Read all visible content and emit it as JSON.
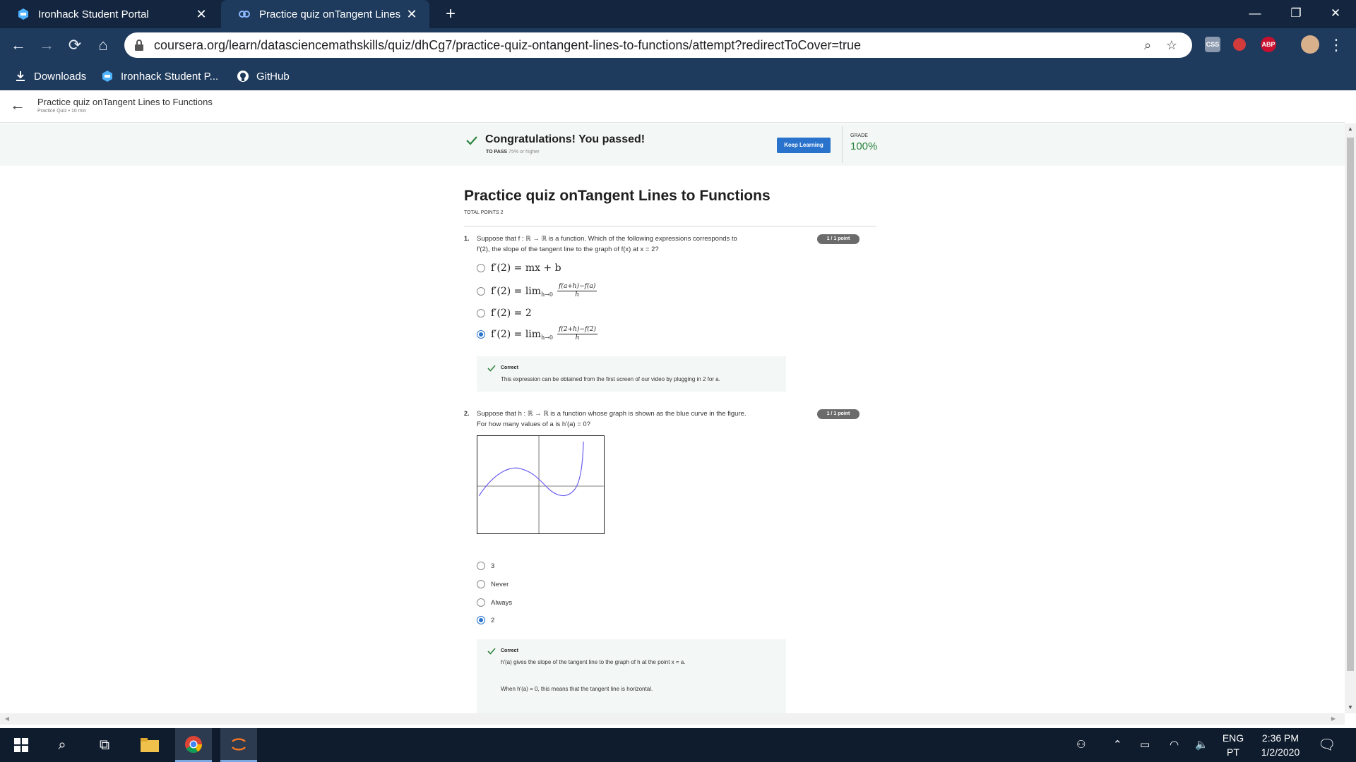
{
  "browser": {
    "tabs": [
      {
        "title": "Ironhack Student Portal",
        "active": false
      },
      {
        "title": "Practice quiz onTangent Lines to",
        "active": true
      }
    ],
    "url": "coursera.org/learn/datasciencemathskills/quiz/dhCg7/practice-quiz-ontangent-lines-to-functions/attempt?redirectToCover=true",
    "bookmarks": [
      {
        "label": "Downloads",
        "icon": "download-icon"
      },
      {
        "label": "Ironhack Student P...",
        "icon": "ironhack-icon"
      },
      {
        "label": "GitHub",
        "icon": "github-icon"
      }
    ],
    "extensions": {
      "abp": "ABP",
      "css": "CSS"
    }
  },
  "page_header": {
    "title": "Practice quiz onTangent Lines to Functions",
    "subtitle": "Practice Quiz • 10 min"
  },
  "banner": {
    "message": "Congratulations! You passed!",
    "to_pass_label": "TO PASS",
    "to_pass_value": "75% or higher",
    "keep_learning": "Keep Learning",
    "grade_label": "GRADE",
    "grade_value": "100%"
  },
  "quiz": {
    "title": "Practice quiz onTangent Lines to Functions",
    "total_points": "TOTAL POINTS 2",
    "questions": [
      {
        "number": "1.",
        "points": "1 / 1 point",
        "text_line1": "Suppose that f : ℝ → ℝ is a function. Which of the following expressions corresponds to",
        "text_line2": "f′(2), the slope of the tangent line to the graph of f(x) at x = 2?",
        "options": [
          {
            "main": "f′(2) = mx + b",
            "selected": false
          },
          {
            "main": "f′(2) = lim",
            "sub": "h→0",
            "num": "f(a+h)−f(a)",
            "den": "h",
            "selected": false
          },
          {
            "main": "f′(2) = 2",
            "selected": false
          },
          {
            "main": "f′(2) = lim",
            "sub": "h→0",
            "num": "f(2+h)−f(2)",
            "den": "h",
            "selected": true
          }
        ],
        "feedback": {
          "title": "Correct",
          "lines": [
            "This expression can be obtained from the first screen of our video by plugging in 2 for a."
          ]
        }
      },
      {
        "number": "2.",
        "points": "1 / 1 point",
        "text_line1": "Suppose that h : ℝ → ℝ is a function whose graph is shown as the blue curve in the figure.",
        "text_line2": "For how many values of a is h′(a) = 0?",
        "options": [
          {
            "main": "3",
            "selected": false
          },
          {
            "main": "Never",
            "selected": false
          },
          {
            "main": "Always",
            "selected": false
          },
          {
            "main": "2",
            "selected": true
          }
        ],
        "feedback": {
          "title": "Correct",
          "lines": [
            "h′(a) gives the slope of the tangent line to the graph of h at the point x = a.",
            "When h′(a) = 0, this means that the tangent line is horizontal."
          ]
        }
      }
    ]
  },
  "taskbar": {
    "language": "ENG",
    "layout": "PT",
    "time": "2:36 PM",
    "date": "1/2/2020"
  },
  "colors": {
    "chrome_dark": "#14263f",
    "chrome": "#1e3a5c",
    "accent_blue": "#2a73cc",
    "success_green": "#2e8540",
    "banner_bg": "#f3f7f5",
    "curve_blue": "#6a5cf0"
  }
}
